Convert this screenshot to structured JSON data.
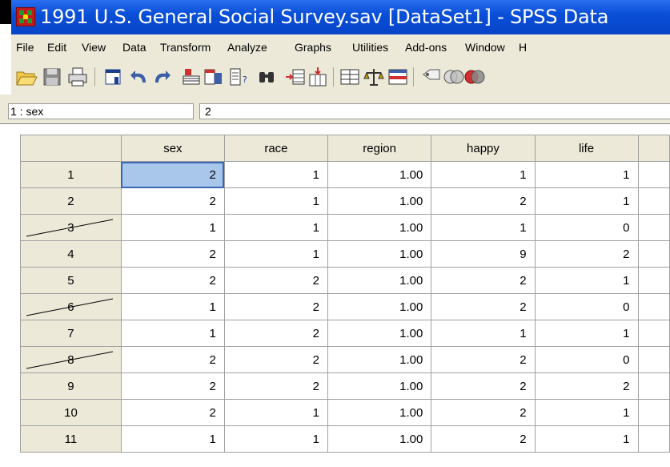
{
  "window": {
    "title": "1991 U.S. General Social Survey.sav [DataSet1] - SPSS Data"
  },
  "menu": [
    {
      "label": "File"
    },
    {
      "label": "Edit"
    },
    {
      "label": "View"
    },
    {
      "label": "Data"
    },
    {
      "label": "Transform"
    },
    {
      "label": "Analyze"
    },
    {
      "label": "Graphs"
    },
    {
      "label": "Utilities"
    },
    {
      "label": "Add-ons"
    },
    {
      "label": "Window"
    },
    {
      "label": "H"
    }
  ],
  "toolbar": {
    "icons": [
      "open-folder-icon",
      "save-icon",
      "print-icon",
      "dialog-recall-icon",
      "undo-icon",
      "redo-icon",
      "goto-case-icon",
      "variables-icon",
      "find-icon",
      "insert-cases-icon",
      "insert-variable-icon",
      "split-file-icon",
      "weight-cases-icon",
      "select-cases-icon",
      "value-labels-icon",
      "use-sets-icon",
      "show-all-variables-icon"
    ]
  },
  "cell_editor": {
    "reference": "1 : sex",
    "value": "2"
  },
  "grid": {
    "columns": [
      "sex",
      "race",
      "region",
      "happy",
      "life"
    ],
    "rows": [
      {
        "id": "1",
        "filtered": false,
        "cells": [
          "2",
          "1",
          "1.00",
          "1",
          "1"
        ]
      },
      {
        "id": "2",
        "filtered": false,
        "cells": [
          "2",
          "1",
          "1.00",
          "2",
          "1"
        ]
      },
      {
        "id": "3",
        "filtered": true,
        "cells": [
          "1",
          "1",
          "1.00",
          "1",
          "0"
        ]
      },
      {
        "id": "4",
        "filtered": false,
        "cells": [
          "2",
          "1",
          "1.00",
          "9",
          "2"
        ]
      },
      {
        "id": "5",
        "filtered": false,
        "cells": [
          "2",
          "2",
          "1.00",
          "2",
          "1"
        ]
      },
      {
        "id": "6",
        "filtered": true,
        "cells": [
          "1",
          "2",
          "1.00",
          "2",
          "0"
        ]
      },
      {
        "id": "7",
        "filtered": false,
        "cells": [
          "1",
          "2",
          "1.00",
          "1",
          "1"
        ]
      },
      {
        "id": "8",
        "filtered": true,
        "cells": [
          "2",
          "2",
          "1.00",
          "2",
          "0"
        ]
      },
      {
        "id": "9",
        "filtered": false,
        "cells": [
          "2",
          "2",
          "1.00",
          "2",
          "2"
        ]
      },
      {
        "id": "10",
        "filtered": false,
        "cells": [
          "2",
          "1",
          "1.00",
          "2",
          "1"
        ]
      },
      {
        "id": "11",
        "filtered": false,
        "cells": [
          "1",
          "1",
          "1.00",
          "2",
          "1"
        ]
      }
    ],
    "selected": {
      "row": 0,
      "col": 0
    },
    "selected_color": "#a9c7ea"
  },
  "colors": {
    "titlebar": "#0a4fd8",
    "chrome": "#ece9d8"
  }
}
